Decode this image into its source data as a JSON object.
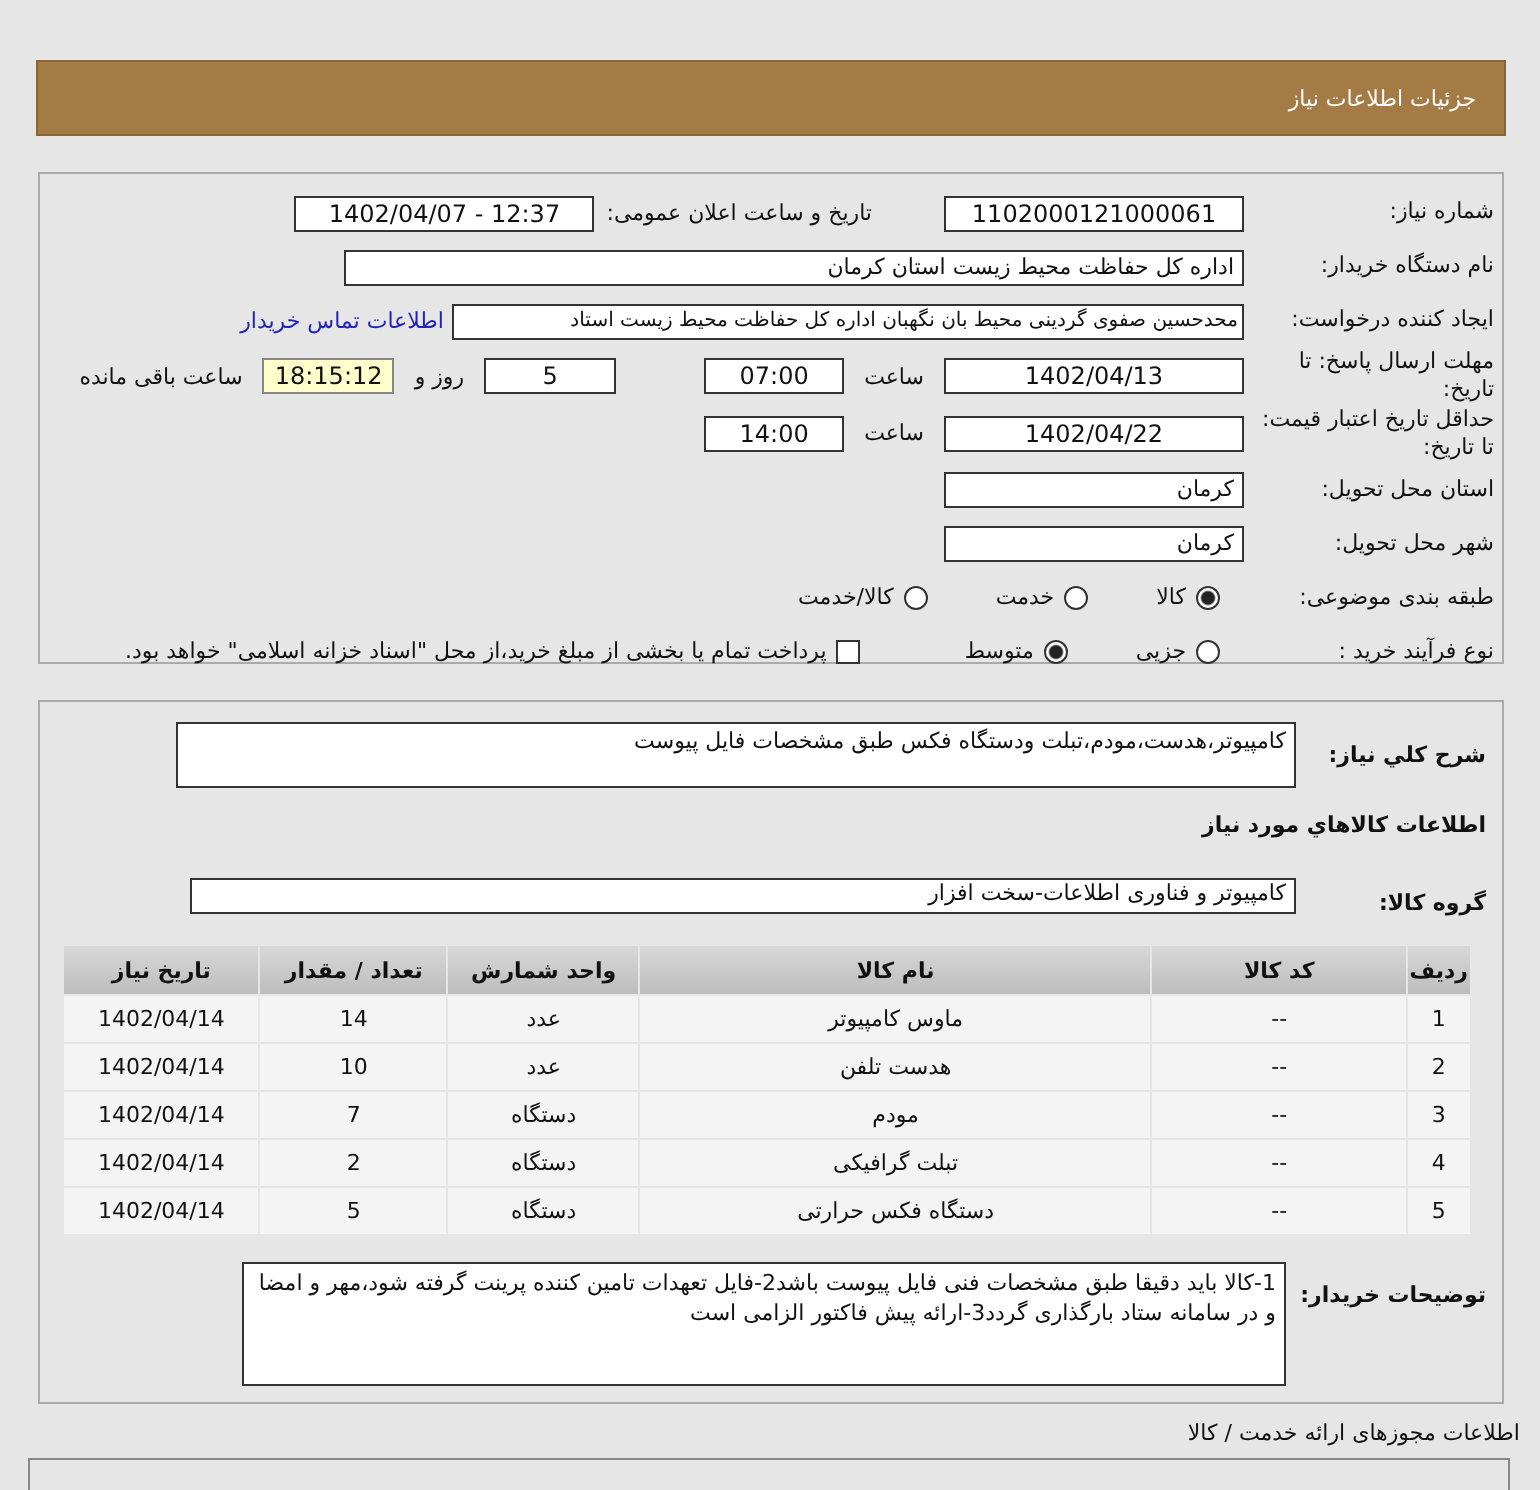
{
  "header": {
    "title": "جزئیات اطلاعات نیاز"
  },
  "info": {
    "need_number_label": "شماره نیاز:",
    "need_number": "1102000121000061",
    "announce_label": "تاریخ و ساعت اعلان عمومی:",
    "announce": "1402/04/07 - 12:37",
    "buyer_label": "نام دستگاه خریدار:",
    "buyer": "اداره کل حفاظت محیط زیست استان کرمان",
    "creator_label": "ایجاد کننده درخواست:",
    "creator": "محدحسین صفوی گردینی محیط بان نگهبان اداره کل حفاظت محیط زیست استاد",
    "contact_link": "اطلاعات تماس خریدار",
    "deadline_label": "مهلت ارسال پاسخ: تا تاریخ:",
    "deadline_date": "1402/04/13",
    "time_label": "ساعت",
    "deadline_time": "07:00",
    "days": "5",
    "days_label": "روز و",
    "remaining": "18:15:12",
    "remaining_label": "ساعت باقی مانده",
    "validity_label": "حداقل تاریخ اعتبار قیمت: تا تاریخ:",
    "validity_date": "1402/04/22",
    "validity_time_label": "ساعت",
    "validity_time": "14:00",
    "province_label": "استان محل تحویل:",
    "province": "کرمان",
    "city_label": "شهر محل تحویل:",
    "city": "کرمان",
    "category_label": "طبقه بندی موضوعی:",
    "category_options": [
      {
        "label": "کالا",
        "selected": true
      },
      {
        "label": "خدمت",
        "selected": false
      },
      {
        "label": "کالا/خدمت",
        "selected": false
      }
    ],
    "purchase_label": "نوع فرآیند خرید :",
    "purchase_options": [
      {
        "label": "جزیی",
        "selected": false
      },
      {
        "label": "متوسط",
        "selected": true
      }
    ],
    "payment": {
      "checked": false,
      "label": "پرداخت تمام یا بخشی از مبلغ خرید،از محل \"اسناد خزانه اسلامی\" خواهد بود."
    }
  },
  "details": {
    "summary_label": "شرح کلي نیاز:",
    "summary": "کامپیوتر،هدست،مودم،تبلت ودستگاه فکس طبق مشخصات فایل پیوست",
    "goods_title": "اطلاعات کالاهاي مورد نیاز",
    "group_label": "گروه کالا:",
    "group": "کامپیوتر و فناوری اطلاعات-سخت افزار",
    "table": {
      "columns": [
        "ردیف",
        "کد کالا",
        "نام کالا",
        "واحد شمارش",
        "تعداد / مقدار",
        "تاریخ نیاز"
      ],
      "rows": [
        [
          "1",
          "--",
          "ماوس کامپیوتر",
          "عدد",
          "14",
          "1402/04/14"
        ],
        [
          "2",
          "--",
          "هدست تلفن",
          "عدد",
          "10",
          "1402/04/14"
        ],
        [
          "3",
          "--",
          "مودم",
          "دستگاه",
          "7",
          "1402/04/14"
        ],
        [
          "4",
          "--",
          "تبلت گرافیکی",
          "دستگاه",
          "2",
          "1402/04/14"
        ],
        [
          "5",
          "--",
          "دستگاه فکس حرارتی",
          "دستگاه",
          "5",
          "1402/04/14"
        ]
      ]
    },
    "notes_label": "توضیحات خریدار:",
    "notes": "1-کالا باید دقیقا طبق مشخصات فنی فایل پیوست باشد2-فایل تعهدات تامین کننده پرینت گرفته شود،مهر و امضا و در سامانه ستاد بارگذاری گردد3-ارائه پیش فاکتور الزامی است"
  },
  "permits": {
    "title": "اطلاعات مجوزهای ارائه خدمت / کالا"
  }
}
